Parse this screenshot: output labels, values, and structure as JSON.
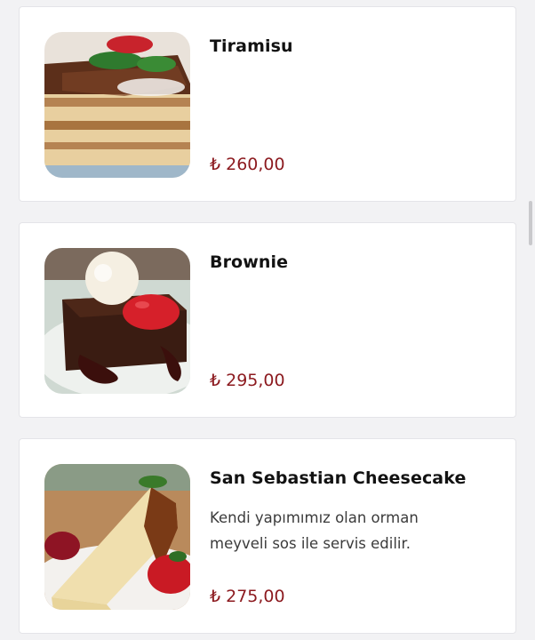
{
  "menu": {
    "items": [
      {
        "name": "Tiramisu",
        "description": "",
        "price": "₺ 260,00",
        "image": "tiramisu-photo"
      },
      {
        "name": "Brownie",
        "description": "",
        "price": "₺ 295,00",
        "image": "brownie-photo"
      },
      {
        "name": "San Sebastian Cheesecake",
        "description": "Kendi yapımımız olan orman meyveli sos ile servis edilir.",
        "price": "₺ 275,00",
        "image": "cheesecake-photo"
      }
    ]
  },
  "colors": {
    "price": "#8c1a1f",
    "card_bg": "#ffffff",
    "page_bg": "#f2f2f4"
  }
}
